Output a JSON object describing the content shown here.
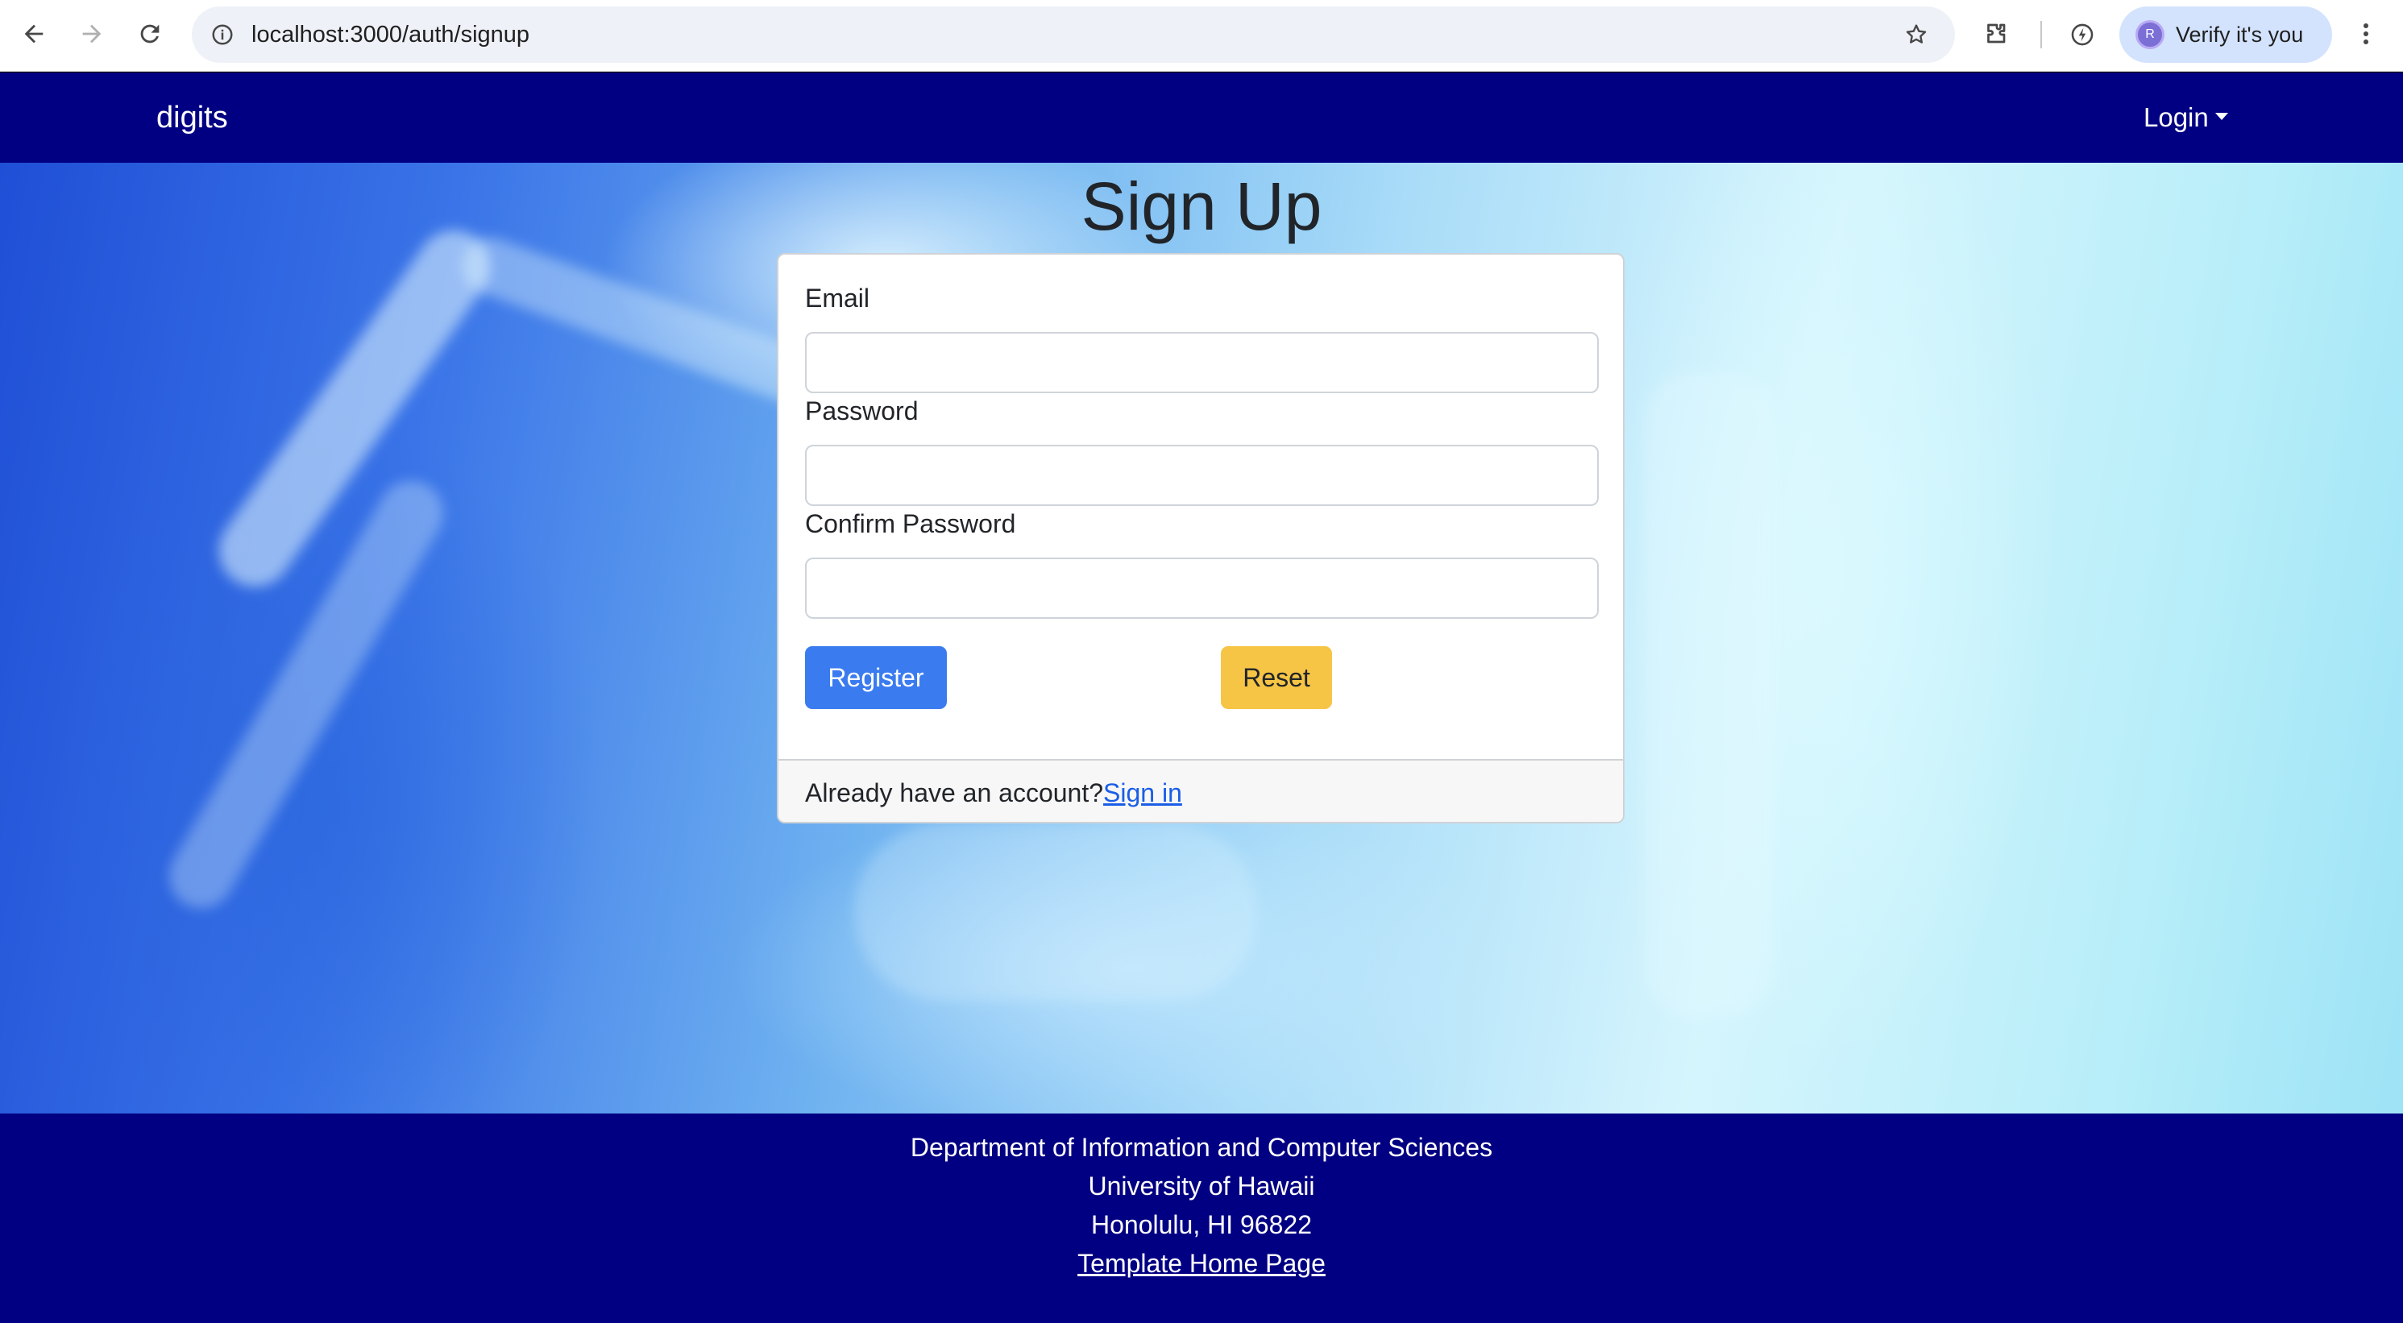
{
  "browser": {
    "url": "localhost:3000/auth/signup",
    "profile_initial": "R",
    "profile_label": "Verify it's you"
  },
  "navbar": {
    "brand": "digits",
    "login_label": "Login"
  },
  "signup": {
    "title": "Sign Up",
    "email_label": "Email",
    "email_value": "",
    "password_label": "Password",
    "password_value": "",
    "confirm_label": "Confirm Password",
    "confirm_value": "",
    "register_label": "Register",
    "reset_label": "Reset",
    "account_prompt": "Already have an account?",
    "signin_label": "Sign in"
  },
  "footer": {
    "line1": "Department of Information and Computer Sciences",
    "line2": "University of Hawaii",
    "line3": "Honolulu, HI 96822",
    "link": "Template Home Page"
  },
  "colors": {
    "navbar": "#020082",
    "register": "#3a7bf0",
    "reset": "#f6c545",
    "link": "#1a5de6"
  }
}
